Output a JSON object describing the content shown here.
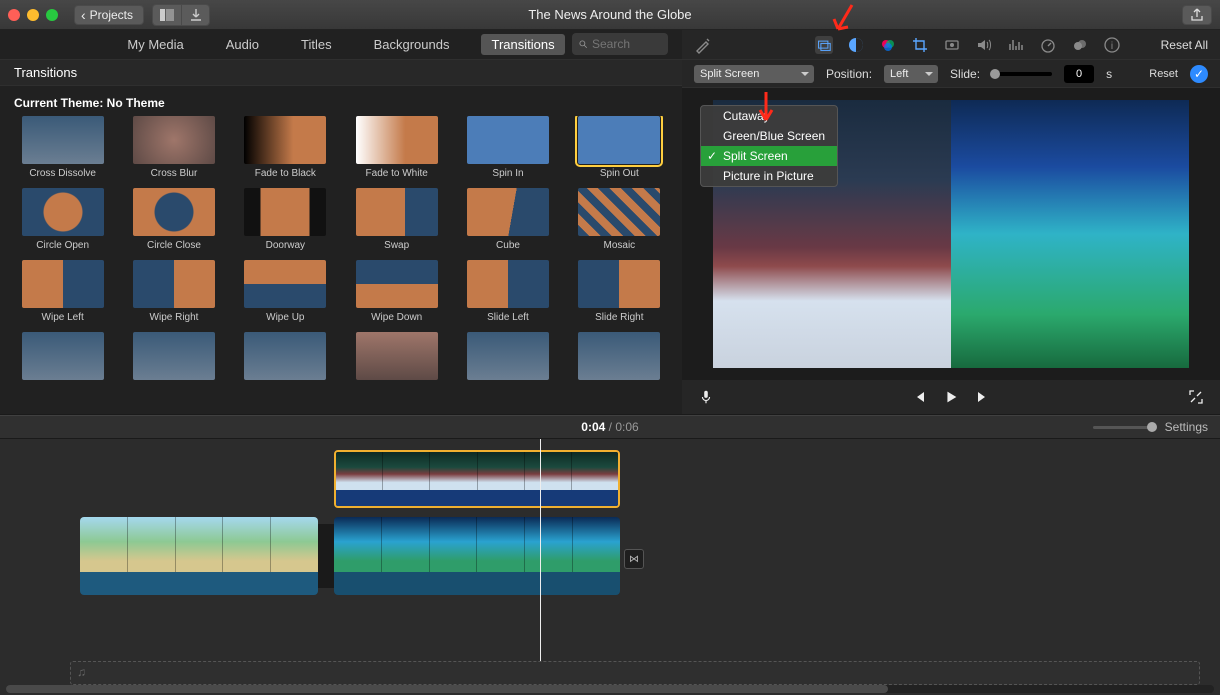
{
  "title": "The News Around the Globe",
  "projects_btn": "Projects",
  "tabs": [
    "My Media",
    "Audio",
    "Titles",
    "Backgrounds",
    "Transitions"
  ],
  "active_tab": "Transitions",
  "search_placeholder": "Search",
  "subheader": "Transitions",
  "theme_line": "Current Theme: No Theme",
  "transitions": [
    "Cross Dissolve",
    "Cross Blur",
    "Fade to Black",
    "Fade to White",
    "Spin In",
    "Spin Out",
    "Circle Open",
    "Circle Close",
    "Doorway",
    "Swap",
    "Cube",
    "Mosaic",
    "Wipe Left",
    "Wipe Right",
    "Wipe Up",
    "Wipe Down",
    "Slide Left",
    "Slide Right",
    "",
    "",
    "",
    "",
    "",
    ""
  ],
  "selected_transition": "Spin Out",
  "right_bar_reset_all": "Reset All",
  "overlay_dd": "Split Screen",
  "overlay_menu": [
    "Cutaway",
    "Green/Blue Screen",
    "Split Screen",
    "Picture in Picture"
  ],
  "overlay_menu_sel": "Split Screen",
  "position_label": "Position:",
  "position_value": "Left",
  "slide_label": "Slide:",
  "sec_value": "0",
  "sec_suffix": "s",
  "reset_label": "Reset",
  "time_current": "0:04",
  "time_total": "0:06",
  "settings_label": "Settings",
  "icons": {
    "wand": "magic-wand-icon",
    "overlay": "overlay-icon",
    "filter": "filter-icon",
    "color": "color-icon",
    "crop": "crop-icon",
    "stab": "stabilize-icon",
    "vol": "volume-icon",
    "eq": "equalizer-icon",
    "speed": "speed-icon",
    "cloud": "noise-reduction-icon",
    "info": "info-icon"
  }
}
